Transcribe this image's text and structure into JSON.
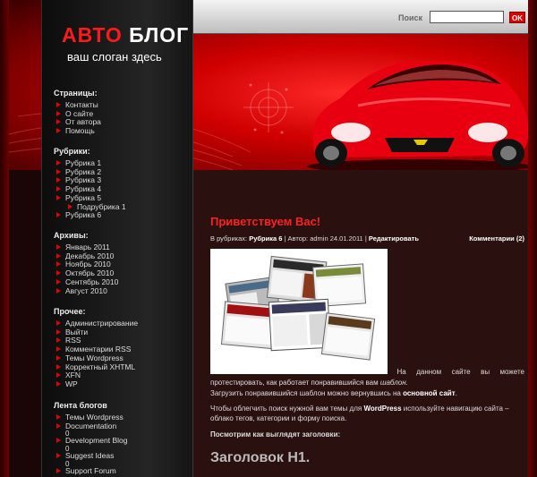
{
  "header": {
    "title_red": "АВТО",
    "title_white": "БЛОГ",
    "slogan": "ваш слоган здесь",
    "search": {
      "label": "Поиск",
      "value": "",
      "button_label": "OK"
    }
  },
  "sidebar": {
    "pages": {
      "heading": "Страницы:",
      "items": [
        "Контакты",
        "О сайте",
        "От автора",
        "Помощь"
      ]
    },
    "categories": {
      "heading": "Рубрики:",
      "items": [
        "Рубрика 1",
        "Рубрика 2",
        "Рубрика 3",
        "Рубрика 4",
        "Рубрика 5",
        "Подрубрика 1",
        "Рубрика 6"
      ]
    },
    "archives": {
      "heading": "Архивы:",
      "items": [
        "Январь 2011",
        "Декабрь 2010",
        "Ноябрь 2010",
        "Октябрь 2010",
        "Сентябрь 2010",
        "Август 2010"
      ]
    },
    "other": {
      "heading": "Прочее:",
      "items": [
        "Администрирование",
        "Выйти",
        "RSS",
        "Комментарии RSS",
        "Темы Wordpress",
        "Корректный XHTML",
        "XFN",
        "WP"
      ]
    },
    "feed": {
      "heading": "Лента блогов",
      "items": [
        "Темы Wordpress",
        "Documentation",
        "Development Blog",
        "Suggest Ideas",
        "Support Forum"
      ],
      "count": "0"
    }
  },
  "post": {
    "title": "Приветствуем Вас!",
    "meta": {
      "categories_label": "В рубриках:",
      "category": "Рубрика 6",
      "author_label": "| Автор: admin",
      "date": "24.01.2011",
      "separator": "|",
      "edit": "Редактировать",
      "comments": "Комментарии (2)"
    },
    "p1_text": "На данном сайте вы можете протестировать, как работает понравившийся вам",
    "p1_em": "шаблон.",
    "p1_line2": "Загрузить понравившийся шаблон можно вернувшись на",
    "p1_link": "основной сайт",
    "p1_end": ".",
    "p2_start": "Чтобы облегчить поиск нужной вам темы для",
    "p2_bold": "WordPress",
    "p2_end": "используйте навигацию сайта – облако тегов, категории и форму поиска.",
    "p3": "Посмотрим как выглядят заголовки:",
    "h1_sample": "Заголовок H1."
  },
  "colors": {
    "accent": "#e00000",
    "background": "#2b1010",
    "sidebar": "#1c1c1c"
  }
}
